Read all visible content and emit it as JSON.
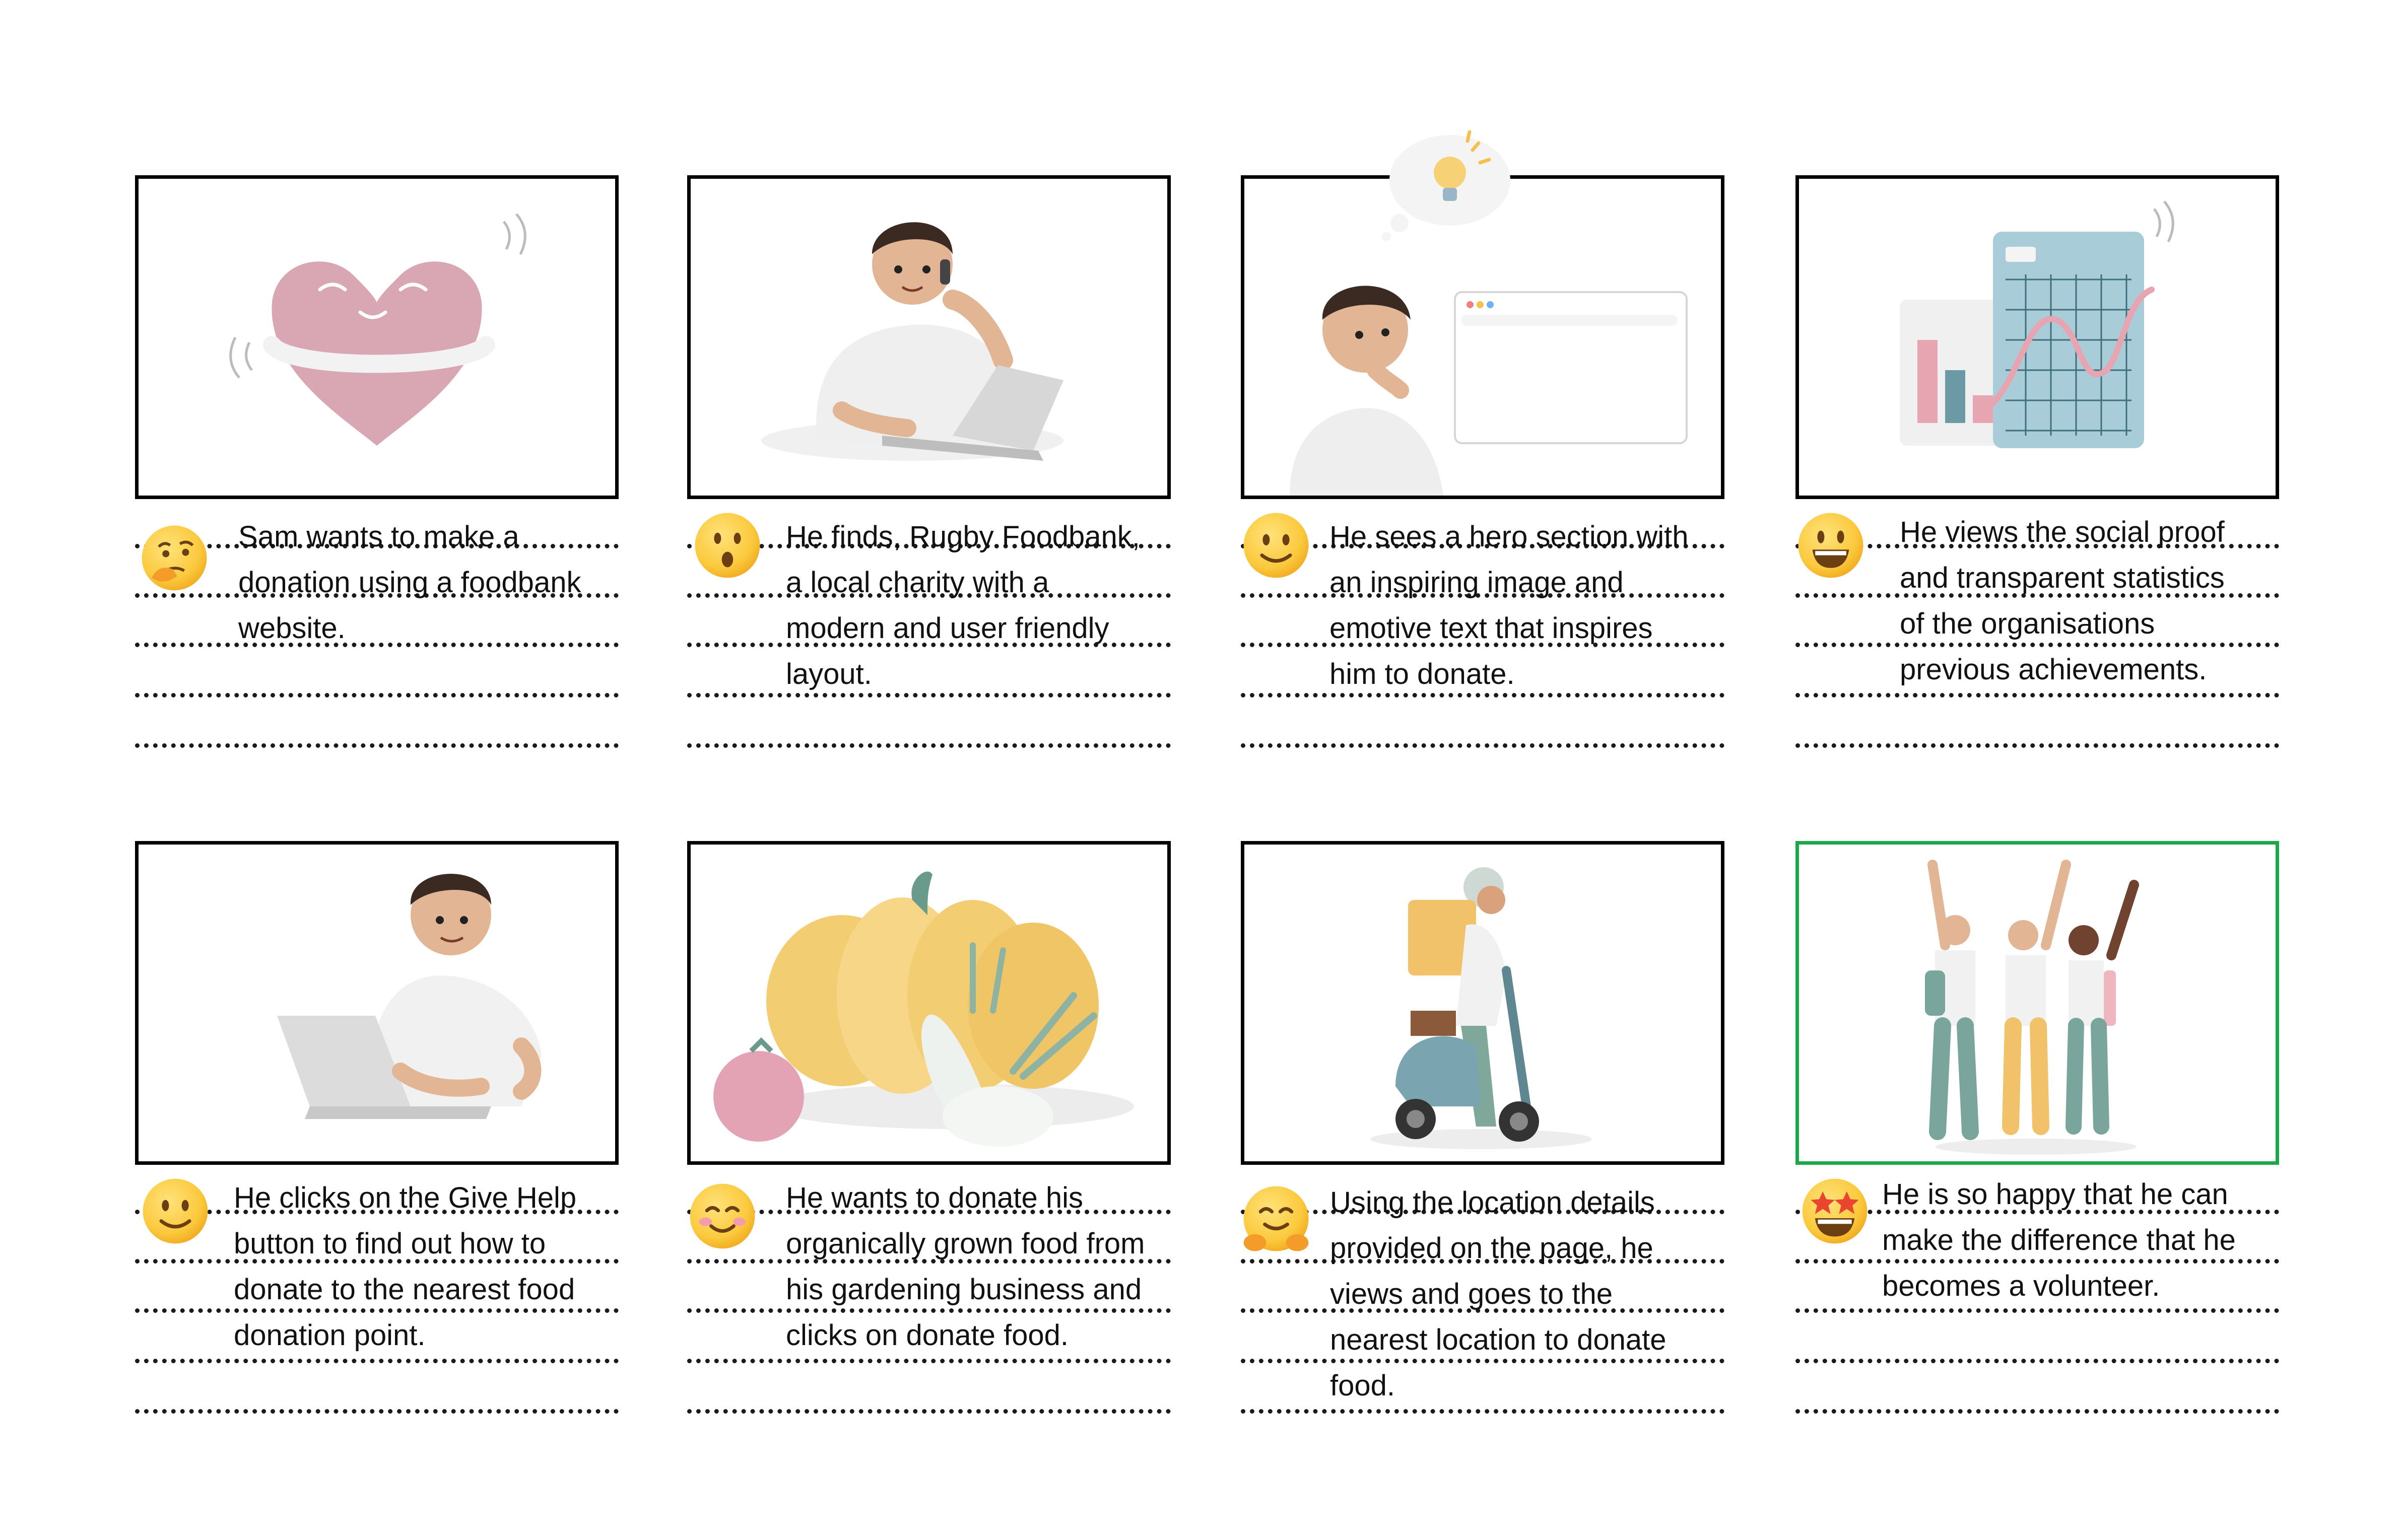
{
  "panels": [
    {
      "caption": "Sam wants to make a\ndonation using a foodbank\nwebsite.",
      "emoji": "thinking-face-icon",
      "scene": "heart-hug-illustration"
    },
    {
      "caption": "He finds, Rugby Foodbank,\na local charity with a\nmodern and user friendly\nlayout.",
      "emoji": "surprised-face-icon",
      "scene": "man-phone-laptop-illustration"
    },
    {
      "caption": "He sees a hero section with\nan inspiring image and\nemotive text that inspires\nhim to donate.",
      "emoji": "slightly-smiling-face-icon",
      "scene": "man-thinking-browser-illustration"
    },
    {
      "caption": "He views the social proof\nand transparent statistics\nof the organisations\nprevious achievements.",
      "emoji": "grinning-face-icon",
      "scene": "statistics-chart-illustration"
    },
    {
      "caption": "He clicks on the Give Help\nbutton to find out how to\ndonate to the nearest food\ndonation point.",
      "emoji": "slightly-smiling-face-icon",
      "scene": "man-laptop-illustration"
    },
    {
      "caption": "He wants to donate his\norganically grown food from\nhis gardening business and\nclicks on donate food.",
      "emoji": "smiling-blush-face-icon",
      "scene": "vegetables-illustration"
    },
    {
      "caption": "Using the location details\nprovided on the page, he\nviews and goes to the\nnearest location to donate\nfood.",
      "emoji": "hugging-face-icon",
      "scene": "delivery-scooter-illustration"
    },
    {
      "caption": "He is so happy that he can\nmake the difference that he\nbecomes a volunteer.",
      "emoji": "star-struck-face-icon",
      "scene": "celebrating-group-illustration"
    }
  ],
  "colors": {
    "frame_border": "#000000",
    "final_frame_border": "#1aa84a",
    "emoji_yellow": "#fbc93d"
  }
}
